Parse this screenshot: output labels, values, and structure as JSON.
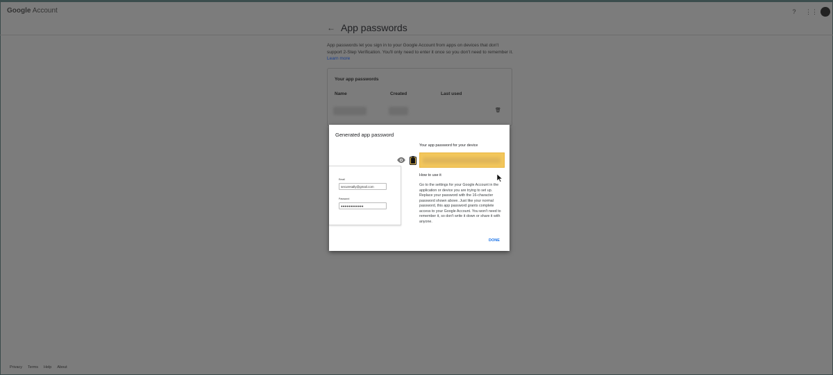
{
  "header": {
    "logo": "Google",
    "account_label": "Account"
  },
  "page": {
    "title": "App passwords",
    "intro": "App passwords let you sign in to your Google Account from apps on devices that don't support 2-Step Verification. You'll only need to enter it once so you don't need to remember it.",
    "learn_more": "Learn more"
  },
  "card": {
    "title": "Your app passwords",
    "columns": [
      "Name",
      "Created",
      "Last used"
    ]
  },
  "modal": {
    "title": "Generated app password",
    "password_label": "Your app password for your device",
    "how_title": "How to use it",
    "instructions": "Go to the settings for your Google Account in the application or device you are trying to set up. Replace your password with the 16-character password shown above. Just like your normal password, this app password grants complete access to your Google Account. You won't need to remember it, so don't write it down or share it with anyone.",
    "done_label": "DONE",
    "preview": {
      "email_label": "Email",
      "email_value": "securesally@gmail.com",
      "password_label": "Password",
      "password_value": "●●●●●●●●●●●●"
    }
  },
  "footer": {
    "links": [
      "Privacy",
      "Terms",
      "Help",
      "About"
    ]
  },
  "colors": {
    "overlay": "#7c7c7c",
    "highlight": "#f3c75c",
    "link": "#1a73e8"
  }
}
